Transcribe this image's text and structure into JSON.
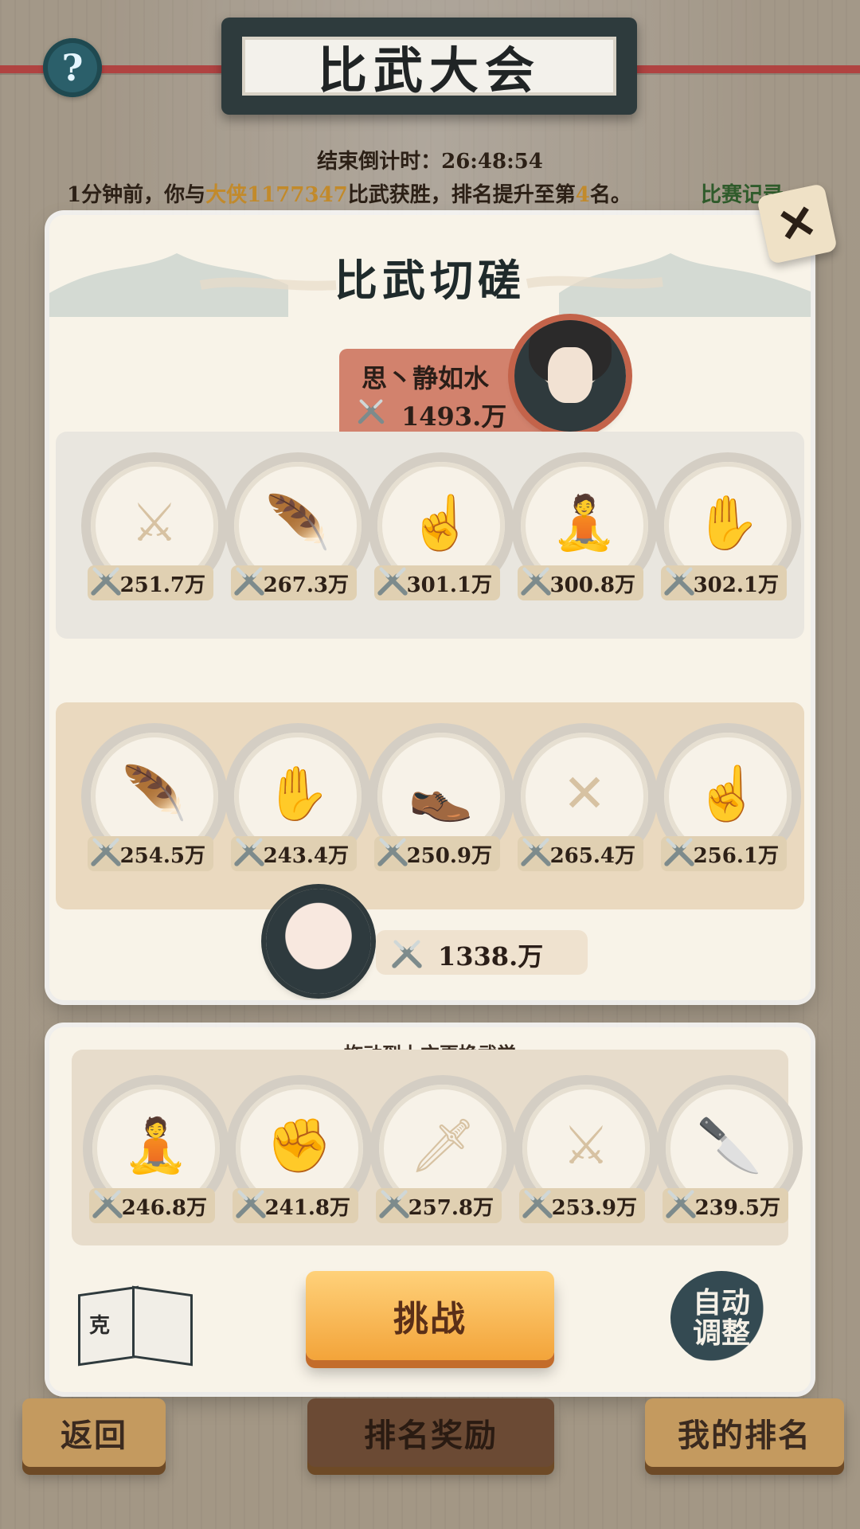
{
  "header": {
    "title": "比武大会",
    "countdown": "结束倒计时：26:48:54",
    "win_msg_prefix": "1分钟前，你与",
    "win_msg_name": "大侠1177347",
    "win_msg_suffix": "比武获胜，排名提升至第",
    "win_msg_rank": "4",
    "win_msg_end": "名。",
    "record_link": "比赛记录"
  },
  "panel": {
    "title": "比武切磋",
    "opponent": {
      "name": "思丶静如水",
      "power": "1493.万"
    },
    "opponent_skills": [
      {
        "power": "251.7万",
        "icon": "sword-icon"
      },
      {
        "power": "267.3万",
        "icon": "feather-icon"
      },
      {
        "power": "301.1万",
        "icon": "finger-icon"
      },
      {
        "power": "300.8万",
        "icon": "meditate-icon"
      },
      {
        "power": "302.1万",
        "icon": "palm-icon"
      }
    ],
    "counter_label": "克",
    "my_skills": [
      {
        "power": "254.5万",
        "icon": "feather-icon"
      },
      {
        "power": "243.4万",
        "icon": "palm-icon"
      },
      {
        "power": "250.9万",
        "icon": "shoe-icon"
      },
      {
        "power": "265.4万",
        "icon": "crossed-spears-icon"
      },
      {
        "power": "256.1万",
        "icon": "finger-icon"
      }
    ],
    "my_power": "1338.万"
  },
  "inventory": {
    "hint": "拖动到上方更换武学",
    "skills": [
      {
        "power": "246.8万",
        "icon": "meditate-icon"
      },
      {
        "power": "241.8万",
        "icon": "fist-icon"
      },
      {
        "power": "257.8万",
        "icon": "blade-icon"
      },
      {
        "power": "253.9万",
        "icon": "long-sword-icon"
      },
      {
        "power": "239.5万",
        "icon": "daggers-icon"
      }
    ],
    "book_label": "克",
    "challenge_label": "挑战",
    "auto_adjust_label": "自动\n调整"
  },
  "bottom_nav": {
    "back": "返回",
    "rank_reward": "排名奖励",
    "my_rank": "我的排名"
  },
  "colors": {
    "accent_orange": "#f3a43a",
    "ke_green": "#86b27e",
    "opponent_red": "#d2826d"
  }
}
